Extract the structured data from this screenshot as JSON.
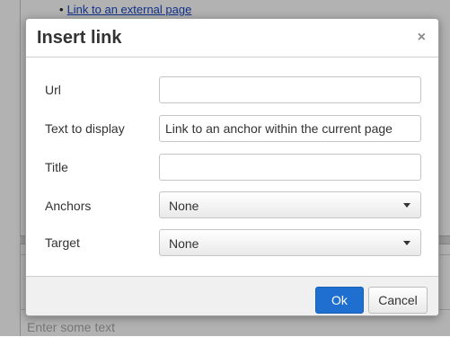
{
  "background": {
    "bullet_link": "Link to an external page",
    "editor_placeholder": "Enter some text"
  },
  "dialog": {
    "title": "Insert link",
    "close_glyph": "×",
    "fields": {
      "url": {
        "label": "Url",
        "value": ""
      },
      "text": {
        "label": "Text to display",
        "value": "Link to an anchor within the current page"
      },
      "title": {
        "label": "Title",
        "value": ""
      },
      "anchors": {
        "label": "Anchors",
        "selected": "None"
      },
      "target": {
        "label": "Target",
        "selected": "None"
      }
    },
    "buttons": {
      "ok": "Ok",
      "cancel": "Cancel"
    }
  },
  "colors": {
    "primary_button": "#1f6fd1",
    "overlay": "rgba(0,0,0,0.30)"
  }
}
